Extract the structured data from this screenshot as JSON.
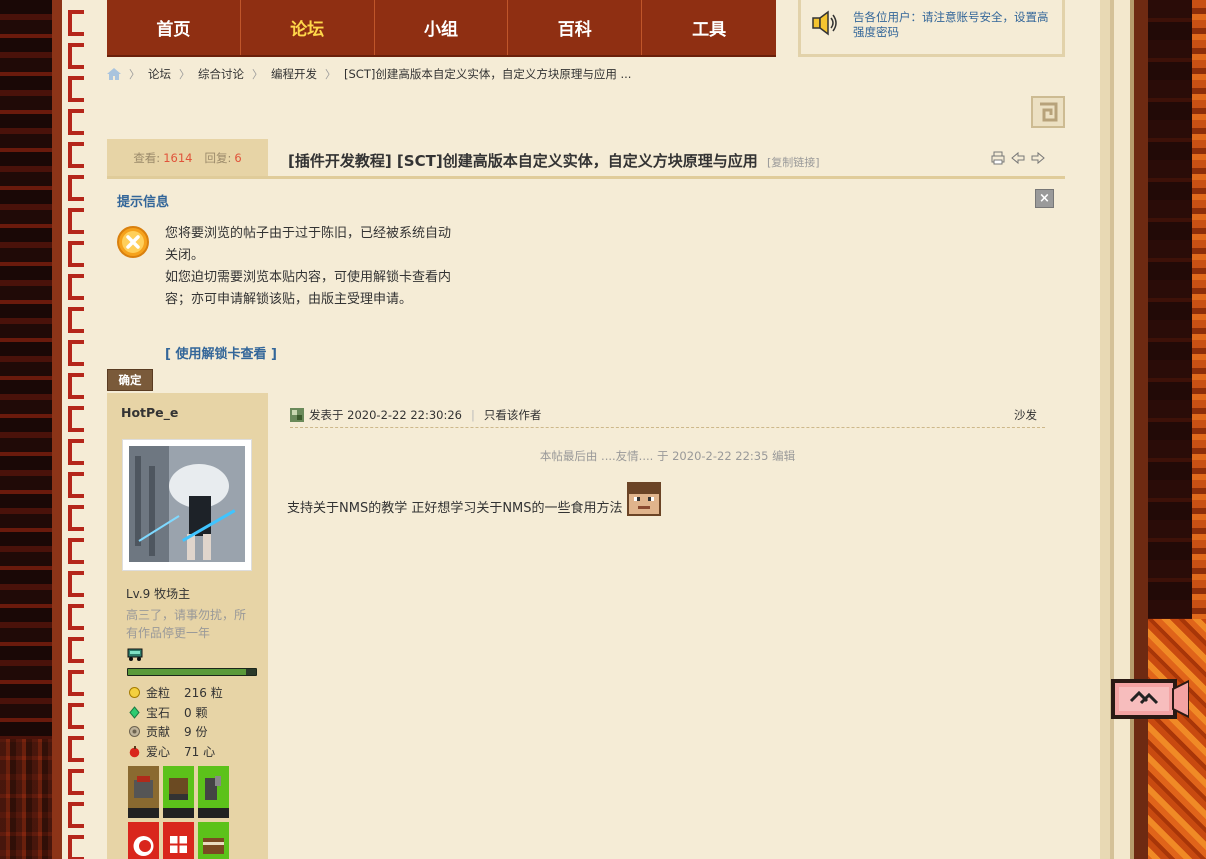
{
  "nav": {
    "items": [
      {
        "label": "首页",
        "active": false
      },
      {
        "label": "论坛",
        "active": true
      },
      {
        "label": "小组",
        "active": false
      },
      {
        "label": "百科",
        "active": false
      },
      {
        "label": "工具",
        "active": false
      }
    ]
  },
  "notice": {
    "text": "告各位用户：请注意账号安全，设置高强度密码"
  },
  "breadcrumb": {
    "items": [
      "论坛",
      "综合讨论",
      "编程开发",
      "[SCT]创建高版本自定义实体，自定义方块原理与应用 ..."
    ]
  },
  "thread": {
    "views_label": "查看:",
    "views": "1614",
    "replies_label": "回复:",
    "replies": "6",
    "title": "[插件开发教程] [SCT]创建高版本自定义实体，自定义方块原理与应用",
    "copy_link": "[复制链接]"
  },
  "prompt": {
    "title": "提示信息",
    "close": "×",
    "line1": "您将要浏览的帖子由于过于陈旧，已经被系统自动关闭。",
    "line2": "如您迫切需要浏览本贴内容，可使用解锁卡查看内容；亦可申请解锁该贴，由版主受理申请。",
    "unlock_link": "[ 使用解锁卡查看 ]",
    "confirm": "确定"
  },
  "author": {
    "name": "HotPe_e",
    "level": "Lv.9 牧场主",
    "signature": "高三了，请事勿扰，所有作品停更一年",
    "progress": 0.92,
    "stats": [
      {
        "icon": "gold-nugget-icon",
        "label": "金粒",
        "value": "216 粒"
      },
      {
        "icon": "emerald-icon",
        "label": "宝石",
        "value": "0 颗"
      },
      {
        "icon": "contribution-icon",
        "label": "贡献",
        "value": "9 份"
      },
      {
        "icon": "apple-heart-icon",
        "label": "爱心",
        "value": "71 心"
      }
    ]
  },
  "post": {
    "posted_label": "发表于 2020-2-22 22:30:26",
    "author_only": "只看该作者",
    "floor": "沙发",
    "edit_note": "本帖最后由 ....友情.... 于 2020-2-22 22:35 编辑",
    "body": "支持关于NMS的教学  正好想学习关于NMS的一些食用方法"
  },
  "colors": {
    "nav_bg": "#8f2f12",
    "nav_active": "#ffd84a",
    "link": "#336699",
    "page_bg": "#f5ecd6",
    "sidebar_bg": "#e7d4a6",
    "count_red": "#e0533a"
  }
}
